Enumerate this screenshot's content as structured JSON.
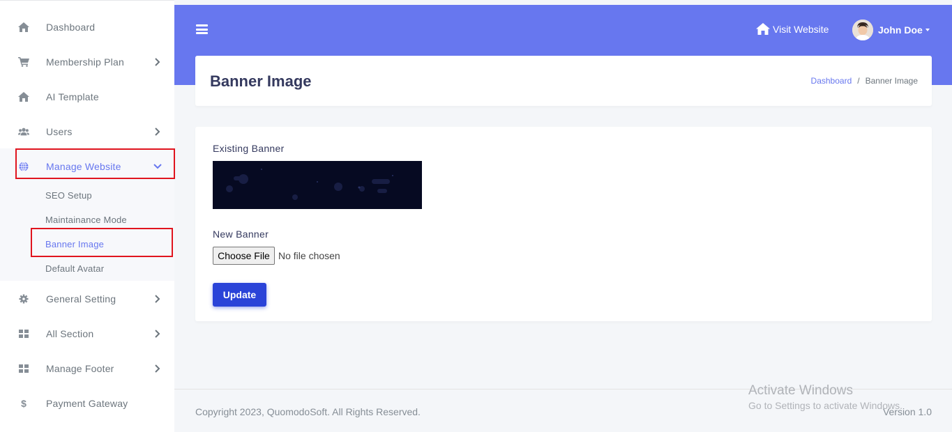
{
  "sidebar": {
    "items": [
      {
        "label": "Dashboard",
        "icon": "home-icon"
      },
      {
        "label": "Membership Plan",
        "icon": "cart-icon"
      },
      {
        "label": "AI Template",
        "icon": "home-icon"
      },
      {
        "label": "Users",
        "icon": "users-icon"
      },
      {
        "label": "Manage Website",
        "icon": "globe-icon"
      },
      {
        "label": "General Setting",
        "icon": "gear-icon"
      },
      {
        "label": "All Section",
        "icon": "grid-icon"
      },
      {
        "label": "Manage Footer",
        "icon": "grid-icon"
      },
      {
        "label": "Payment Gateway",
        "icon": "dollar-icon"
      }
    ],
    "submenu": [
      {
        "label": "SEO Setup"
      },
      {
        "label": "Maintainance Mode"
      },
      {
        "label": "Banner Image"
      },
      {
        "label": "Default Avatar"
      }
    ]
  },
  "header": {
    "visit_label": "Visit Website",
    "user_name": "John Doe",
    "accent_color": "#6777ef"
  },
  "page": {
    "title": "Banner Image",
    "breadcrumb": [
      "Dashboard",
      "Banner Image"
    ],
    "breadcrumb_sep": "/"
  },
  "form": {
    "existing_label": "Existing Banner",
    "new_label": "New Banner",
    "choose_file_label": "Choose File",
    "no_file_text": "No file chosen",
    "update_label": "Update"
  },
  "footer": {
    "copyright": "Copyright 2023, QuomodoSoft. All Rights Reserved.",
    "version": "Version 1.0"
  },
  "watermark": {
    "line1": "Activate Windows",
    "line2": "Go to Settings to activate Windows."
  }
}
